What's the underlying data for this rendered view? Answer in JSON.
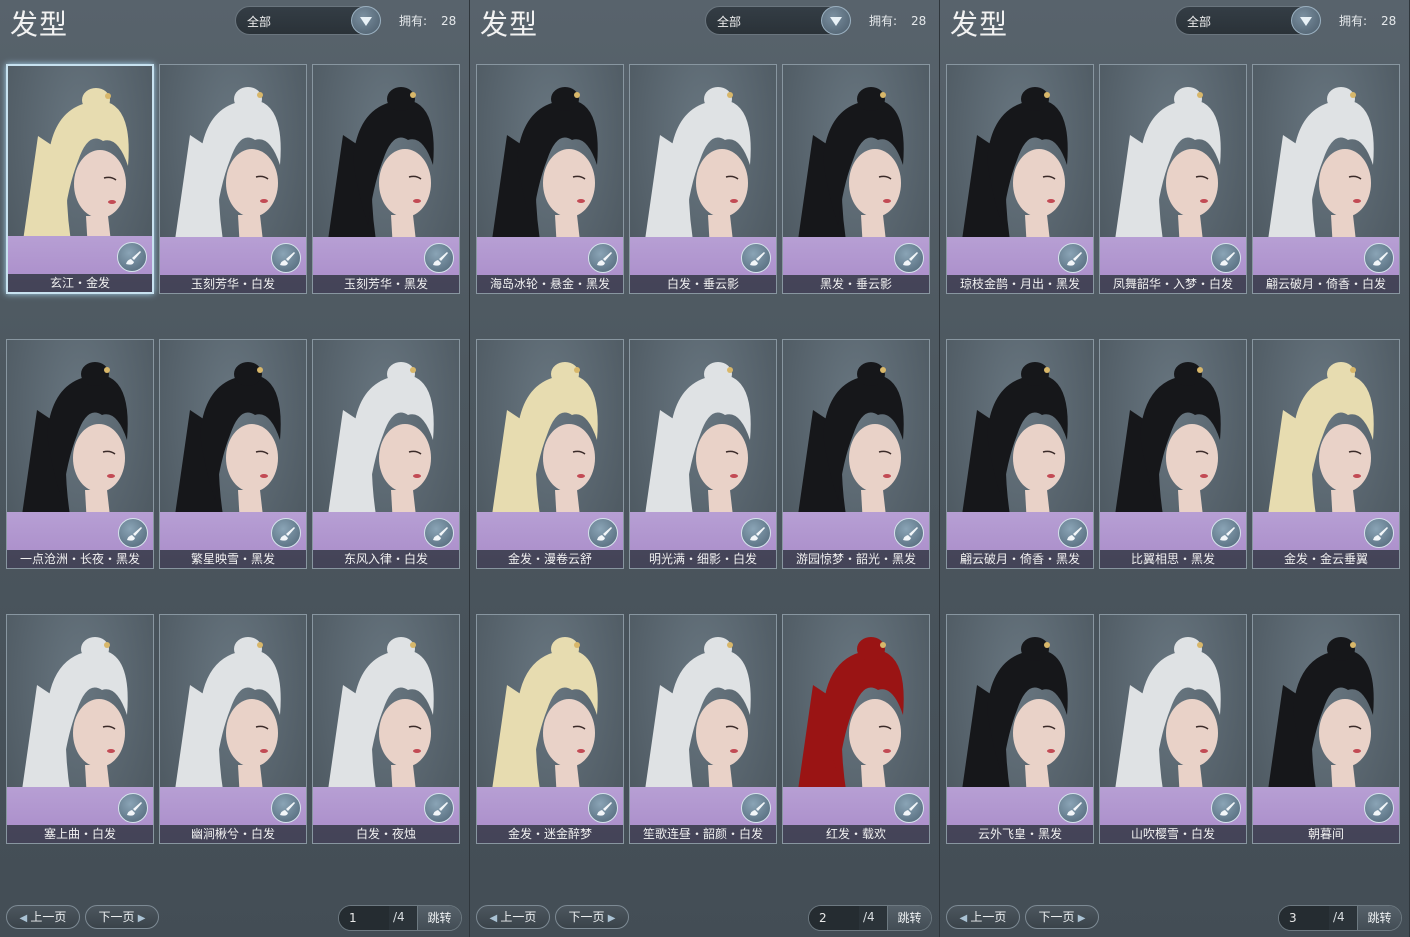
{
  "colors": {
    "black_hair": "#16171a",
    "white_hair": "#dfe2e4",
    "blonde_hair": "#e7dcb0",
    "red_hair": "#9a1414",
    "shoulder": "#b59dd2",
    "skin": "#e9d2c8"
  },
  "panels": [
    {
      "title": "发型",
      "filter": "全部",
      "owned_label": "拥有:",
      "owned_count": "28",
      "items": [
        {
          "name": "玄江・金发",
          "hair": "blonde_hair",
          "selected": true
        },
        {
          "name": "玉刻芳华・白发",
          "hair": "white_hair",
          "selected": false
        },
        {
          "name": "玉刻芳华・黑发",
          "hair": "black_hair",
          "selected": false
        },
        {
          "name": "一点沧洲・长夜・黑发",
          "hair": "black_hair",
          "selected": false
        },
        {
          "name": "繁星映雪・黑发",
          "hair": "black_hair",
          "selected": false
        },
        {
          "name": "东风入律・白发",
          "hair": "white_hair",
          "selected": false
        },
        {
          "name": "塞上曲・白发",
          "hair": "white_hair",
          "selected": false
        },
        {
          "name": "幽涧楸兮・白发",
          "hair": "white_hair",
          "selected": false
        },
        {
          "name": "白发・夜烛",
          "hair": "white_hair",
          "selected": false
        }
      ],
      "pager": {
        "prev": "上一页",
        "next": "下一页",
        "page": "1",
        "total": "/4",
        "jump": "跳转"
      }
    },
    {
      "title": "发型",
      "filter": "全部",
      "owned_label": "拥有:",
      "owned_count": "28",
      "items": [
        {
          "name": "海岛冰轮・悬金・黑发",
          "hair": "black_hair",
          "selected": false
        },
        {
          "name": "白发・垂云影",
          "hair": "white_hair",
          "selected": false
        },
        {
          "name": "黑发・垂云影",
          "hair": "black_hair",
          "selected": false
        },
        {
          "name": "金发・漫卷云舒",
          "hair": "blonde_hair",
          "selected": false
        },
        {
          "name": "明光满・细影・白发",
          "hair": "white_hair",
          "selected": false
        },
        {
          "name": "游园惊梦・韶光・黑发",
          "hair": "black_hair",
          "selected": false
        },
        {
          "name": "金发・迷金醉梦",
          "hair": "blonde_hair",
          "selected": false
        },
        {
          "name": "笙歌连昼・韶颜・白发",
          "hair": "white_hair",
          "selected": false
        },
        {
          "name": "红发・载欢",
          "hair": "red_hair",
          "selected": false
        }
      ],
      "pager": {
        "prev": "上一页",
        "next": "下一页",
        "page": "2",
        "total": "/4",
        "jump": "跳转"
      }
    },
    {
      "title": "发型",
      "filter": "全部",
      "owned_label": "拥有:",
      "owned_count": "28",
      "items": [
        {
          "name": "琼枝金鹊・月出・黑发",
          "hair": "black_hair",
          "selected": false
        },
        {
          "name": "凤舞韶华・入梦・白发",
          "hair": "white_hair",
          "selected": false
        },
        {
          "name": "翩云破月・倚香・白发",
          "hair": "white_hair",
          "selected": false
        },
        {
          "name": "翩云破月・倚香・黑发",
          "hair": "black_hair",
          "selected": false
        },
        {
          "name": "比翼相思・黑发",
          "hair": "black_hair",
          "selected": false
        },
        {
          "name": "金发・金云垂翼",
          "hair": "blonde_hair",
          "selected": false
        },
        {
          "name": "云外飞皇・黑发",
          "hair": "black_hair",
          "selected": false
        },
        {
          "name": "山吹樱雪・白发",
          "hair": "white_hair",
          "selected": false
        },
        {
          "name": "朝暮间",
          "hair": "black_hair",
          "selected": false
        }
      ],
      "pager": {
        "prev": "上一页",
        "next": "下一页",
        "page": "3",
        "total": "/4",
        "jump": "跳转"
      }
    }
  ]
}
